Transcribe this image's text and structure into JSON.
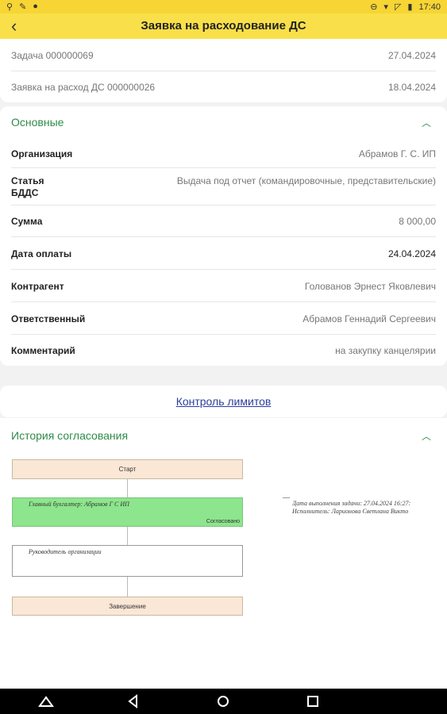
{
  "status_bar": {
    "time": "17:40"
  },
  "header": {
    "title": "Заявка на расходование ДС"
  },
  "task": {
    "task_label": "Задача 000000069",
    "task_date": "27.04.2024",
    "request_label": "Заявка на расход ДС 000000026",
    "request_date": "18.04.2024"
  },
  "main_section": {
    "title": "Основные",
    "fields": [
      {
        "label": "Организация",
        "value": "Абрамов Г. С. ИП"
      },
      {
        "label": "Статья\nБДДС",
        "value": "Выдача под отчет (командировочные, представительские)"
      },
      {
        "label": "Сумма",
        "value": "8 000,00"
      },
      {
        "label": "Дата оплаты",
        "value": "24.04.2024"
      },
      {
        "label": "Контрагент",
        "value": "Голованов Эрнест Яковлевич"
      },
      {
        "label": "Ответственный",
        "value": "Абрамов Геннадий Сергеевич"
      },
      {
        "label": "Комментарий",
        "value": "на закупку канцелярии"
      }
    ]
  },
  "limits_button": "Контроль лимитов",
  "history": {
    "title": "История согласования",
    "start": "Старт",
    "step1_text": "Главный бухгалтер: Абрамов Г С ИП",
    "step1_status": "Согласовано",
    "step2_text": "Руководитель организации",
    "end": "Завершение",
    "note_line1": "Дата выполнения задачи: 27.04.2024 16:27:",
    "note_line2": "Исполнитель: Ларионова Светлана Викто"
  }
}
